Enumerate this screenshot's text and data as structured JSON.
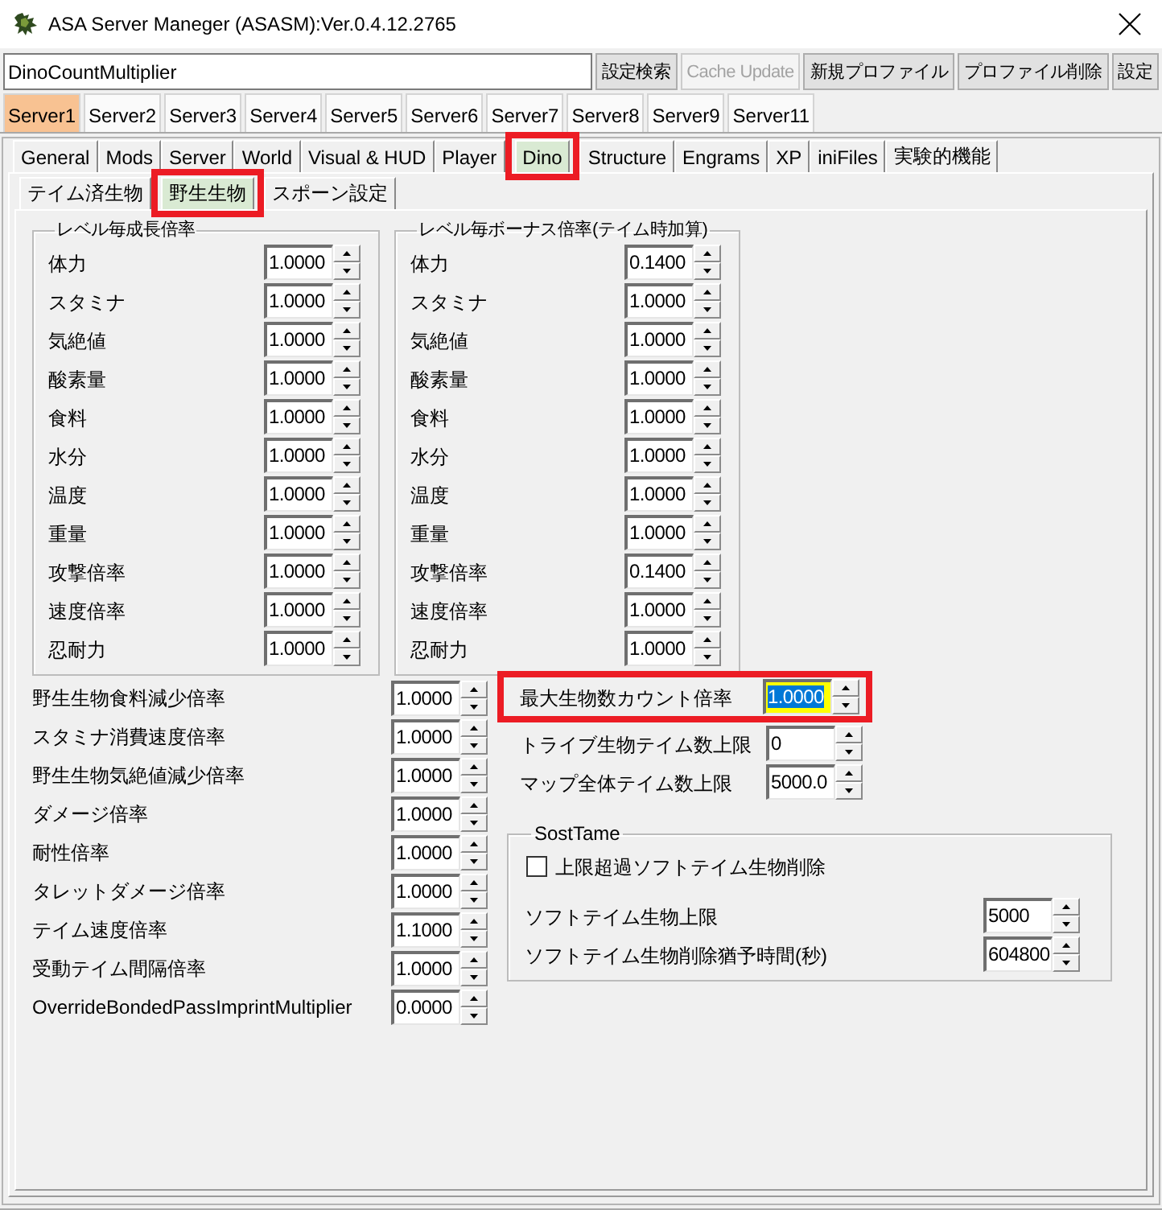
{
  "window": {
    "title": "ASA Server Maneger (ASASM):Ver.0.4.12.2765"
  },
  "toolbar": {
    "search": {
      "value": "DinoCountMultiplier"
    },
    "buttons": [
      {
        "label": "設定検索",
        "disabled": false
      },
      {
        "label": "Cache Update",
        "disabled": true
      },
      {
        "label": "新規プロファイル",
        "disabled": false
      },
      {
        "label": "プロファイル削除",
        "disabled": false
      },
      {
        "label": "設定",
        "disabled": false
      }
    ]
  },
  "server_tabs": [
    {
      "label": "Server1",
      "selected": true
    },
    {
      "label": "Server2",
      "selected": false
    },
    {
      "label": "Server3",
      "selected": false
    },
    {
      "label": "Server4",
      "selected": false
    },
    {
      "label": "Server5",
      "selected": false
    },
    {
      "label": "Server6",
      "selected": false
    },
    {
      "label": "Server7",
      "selected": false
    },
    {
      "label": "Server8",
      "selected": false
    },
    {
      "label": "Server9",
      "selected": false
    },
    {
      "label": "Server11",
      "selected": false
    }
  ],
  "section_tabs": [
    {
      "label": "General",
      "selected": false,
      "highlighted": false
    },
    {
      "label": "Mods",
      "selected": false,
      "highlighted": false
    },
    {
      "label": "Server",
      "selected": false,
      "highlighted": false
    },
    {
      "label": "World",
      "selected": false,
      "highlighted": false
    },
    {
      "label": "Visual & HUD",
      "selected": false,
      "highlighted": false
    },
    {
      "label": "Player",
      "selected": false,
      "highlighted": false
    },
    {
      "label": "Dino",
      "selected": true,
      "highlighted": true
    },
    {
      "label": "Structure",
      "selected": false,
      "highlighted": false
    },
    {
      "label": "Engrams",
      "selected": false,
      "highlighted": false
    },
    {
      "label": "XP",
      "selected": false,
      "highlighted": false
    },
    {
      "label": "iniFiles",
      "selected": false,
      "highlighted": false
    },
    {
      "label": "実験的機能",
      "selected": false,
      "highlighted": false
    }
  ],
  "dino_tabs": [
    {
      "label": "テイム済生物",
      "selected": false,
      "highlighted": false
    },
    {
      "label": "野生生物",
      "selected": true,
      "highlighted": true
    },
    {
      "label": "スポーン設定",
      "selected": false,
      "highlighted": false
    }
  ],
  "growth_group": {
    "title": "レベル毎成長倍率",
    "rows": [
      {
        "label": "体力",
        "value": "1.0000"
      },
      {
        "label": "スタミナ",
        "value": "1.0000"
      },
      {
        "label": "気絶値",
        "value": "1.0000"
      },
      {
        "label": "酸素量",
        "value": "1.0000"
      },
      {
        "label": "食料",
        "value": "1.0000"
      },
      {
        "label": "水分",
        "value": "1.0000"
      },
      {
        "label": "温度",
        "value": "1.0000"
      },
      {
        "label": "重量",
        "value": "1.0000"
      },
      {
        "label": "攻撃倍率",
        "value": "1.0000"
      },
      {
        "label": "速度倍率",
        "value": "1.0000"
      },
      {
        "label": "忍耐力",
        "value": "1.0000"
      }
    ]
  },
  "bonus_group": {
    "title": "レベル毎ボーナス倍率(テイム時加算)",
    "rows": [
      {
        "label": "体力",
        "value": "0.1400"
      },
      {
        "label": "スタミナ",
        "value": "1.0000"
      },
      {
        "label": "気絶値",
        "value": "1.0000"
      },
      {
        "label": "酸素量",
        "value": "1.0000"
      },
      {
        "label": "食料",
        "value": "1.0000"
      },
      {
        "label": "水分",
        "value": "1.0000"
      },
      {
        "label": "温度",
        "value": "1.0000"
      },
      {
        "label": "重量",
        "value": "1.0000"
      },
      {
        "label": "攻撃倍率",
        "value": "0.1400"
      },
      {
        "label": "速度倍率",
        "value": "1.0000"
      },
      {
        "label": "忍耐力",
        "value": "1.0000"
      }
    ]
  },
  "wild_settings": [
    {
      "label": "野生生物食料減少倍率",
      "value": "1.0000"
    },
    {
      "label": "スタミナ消費速度倍率",
      "value": "1.0000"
    },
    {
      "label": "野生生物気絶値減少倍率",
      "value": "1.0000"
    },
    {
      "label": "ダメージ倍率",
      "value": "1.0000"
    },
    {
      "label": "耐性倍率",
      "value": "1.0000"
    },
    {
      "label": "タレットダメージ倍率",
      "value": "1.0000"
    },
    {
      "label": "テイム速度倍率",
      "value": "1.1000"
    },
    {
      "label": "受動テイム間隔倍率",
      "value": "1.0000"
    },
    {
      "label": "OverrideBondedPassImprintMultiplier",
      "value": "0.0000"
    }
  ],
  "limits": [
    {
      "label": "最大生物数カウント倍率",
      "value": "1.0000",
      "highlighted": true,
      "focused": true
    },
    {
      "label": "トライブ生物テイム数上限",
      "value": "0",
      "highlighted": false,
      "focused": false
    },
    {
      "label": "マップ全体テイム数上限",
      "value": "5000.0",
      "highlighted": false,
      "focused": false
    }
  ],
  "soft_tame": {
    "title": "SostTame",
    "checkbox": {
      "label": "上限超過ソフトテイム生物削除",
      "checked": false
    },
    "rows": [
      {
        "label": "ソフトテイム生物上限",
        "value": "5000"
      },
      {
        "label": "ソフトテイム生物削除猶予時間(秒)",
        "value": "604800"
      }
    ]
  }
}
